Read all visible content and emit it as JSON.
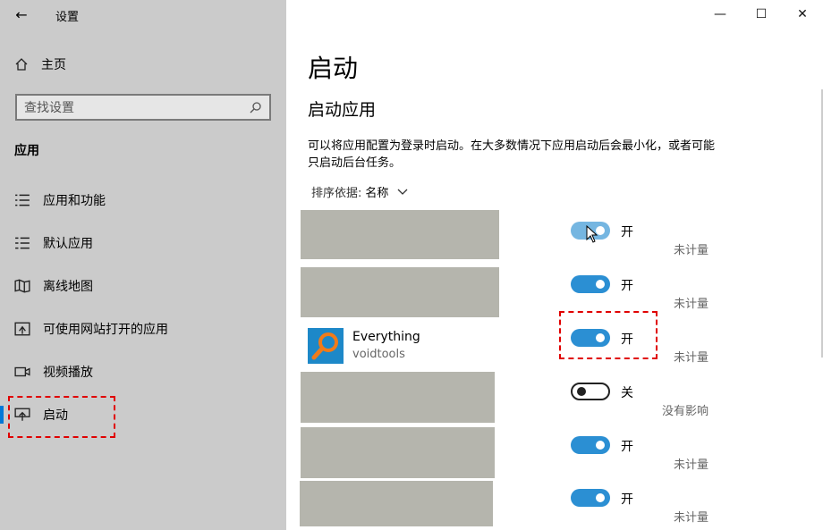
{
  "window": {
    "title": "设置"
  },
  "sidebar": {
    "home_label": "主页",
    "search_placeholder": "查找设置",
    "section_label": "应用",
    "items": [
      {
        "label": "应用和功能",
        "icon": "list-icon"
      },
      {
        "label": "默认应用",
        "icon": "default-apps-icon"
      },
      {
        "label": "离线地图",
        "icon": "map-icon"
      },
      {
        "label": "可使用网站打开的应用",
        "icon": "website-app-icon"
      },
      {
        "label": "视频播放",
        "icon": "video-icon"
      },
      {
        "label": "启动",
        "icon": "startup-icon",
        "active": true
      }
    ]
  },
  "main": {
    "title": "启动",
    "subtitle": "启动应用",
    "description": "可以将应用配置为登录时启动。在大多数情况下应用启动后会最小化，或者可能只启动后台任务。",
    "sort_label": "排序依据:",
    "sort_value": "名称",
    "apps": [
      {
        "name": "",
        "publisher": "",
        "state": "开",
        "on": true,
        "impact": "未计量"
      },
      {
        "name": "",
        "publisher": "",
        "state": "开",
        "on": true,
        "impact": "未计量"
      },
      {
        "name": "Everything",
        "publisher": "voidtools",
        "state": "开",
        "on": true,
        "impact": "未计量"
      },
      {
        "name": "",
        "publisher": "",
        "state": "关",
        "on": false,
        "impact": "没有影响"
      },
      {
        "name": "",
        "publisher": "",
        "state": "开",
        "on": true,
        "impact": "未计量"
      },
      {
        "name": "",
        "publisher": "",
        "state": "开",
        "on": true,
        "impact": "未计量"
      }
    ]
  },
  "colors": {
    "accent": "#0078d7",
    "toggle_on": "#2b8fd3",
    "highlight": "#e00000",
    "sidebar_bg": "#cbcbcb"
  }
}
